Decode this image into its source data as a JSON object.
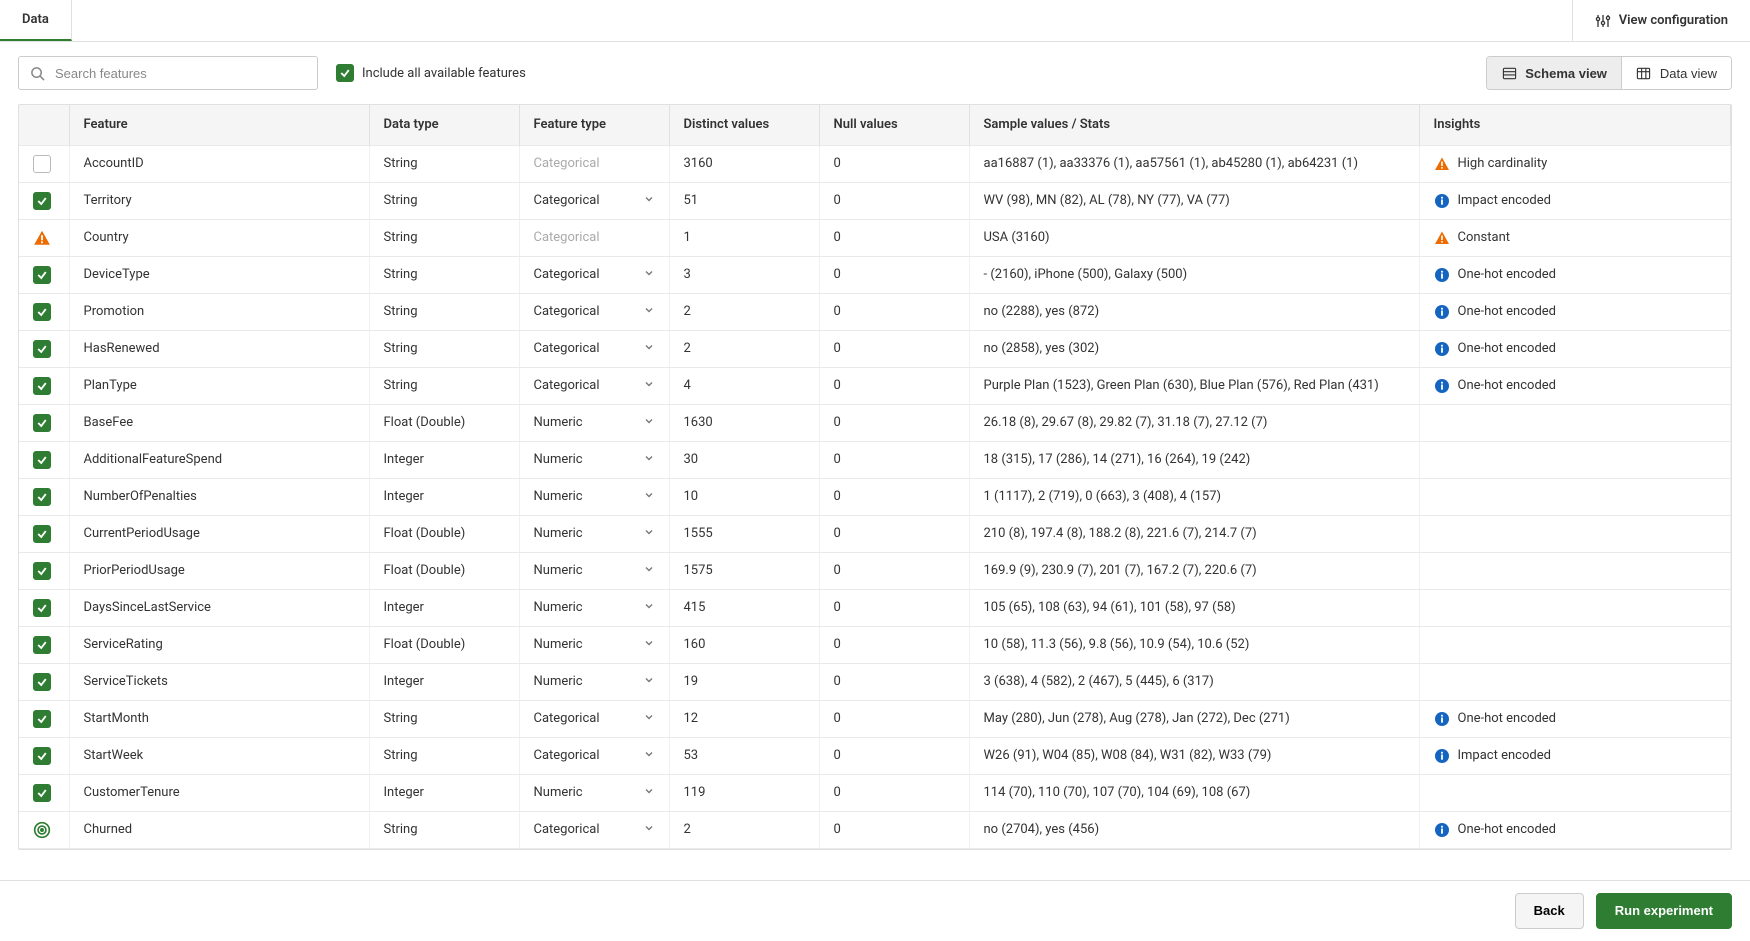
{
  "tabs": {
    "data": "Data"
  },
  "topbar": {
    "view_configuration": "View configuration"
  },
  "toolbar": {
    "search_placeholder": "Search features",
    "include_all": "Include all available features",
    "schema_view": "Schema view",
    "data_view": "Data view"
  },
  "columns": {
    "feature": "Feature",
    "data_type": "Data type",
    "feature_type": "Feature type",
    "distinct": "Distinct values",
    "nulls": "Null values",
    "samples": "Sample values / Stats",
    "insights": "Insights"
  },
  "insight_labels": {
    "high_cardinality": "High cardinality",
    "impact_encoded": "Impact encoded",
    "constant": "Constant",
    "one_hot": "One-hot encoded"
  },
  "footer": {
    "back": "Back",
    "run": "Run experiment"
  },
  "rows": [
    {
      "sel": "unchecked",
      "feature": "AccountID",
      "data_type": "String",
      "feature_type": "Categorical",
      "ft_muted": true,
      "ft_chevron": false,
      "distinct": "3160",
      "nulls": "0",
      "samples": "aa16887 (1), aa33376 (1), aa57561 (1), ab45280 (1), ab64231 (1)",
      "insight_icon": "warn",
      "insight_key": "high_cardinality"
    },
    {
      "sel": "checked",
      "feature": "Territory",
      "data_type": "String",
      "feature_type": "Categorical",
      "ft_muted": false,
      "ft_chevron": true,
      "distinct": "51",
      "nulls": "0",
      "samples": "WV (98), MN (82), AL (78), NY (77), VA (77)",
      "insight_icon": "info",
      "insight_key": "impact_encoded"
    },
    {
      "sel": "warn",
      "feature": "Country",
      "data_type": "String",
      "feature_type": "Categorical",
      "ft_muted": true,
      "ft_chevron": false,
      "distinct": "1",
      "nulls": "0",
      "samples": "USA (3160)",
      "insight_icon": "warn",
      "insight_key": "constant"
    },
    {
      "sel": "checked",
      "feature": "DeviceType",
      "data_type": "String",
      "feature_type": "Categorical",
      "ft_muted": false,
      "ft_chevron": true,
      "distinct": "3",
      "nulls": "0",
      "samples": "- (2160), iPhone (500), Galaxy (500)",
      "insight_icon": "info",
      "insight_key": "one_hot"
    },
    {
      "sel": "checked",
      "feature": "Promotion",
      "data_type": "String",
      "feature_type": "Categorical",
      "ft_muted": false,
      "ft_chevron": true,
      "distinct": "2",
      "nulls": "0",
      "samples": "no (2288), yes (872)",
      "insight_icon": "info",
      "insight_key": "one_hot"
    },
    {
      "sel": "checked",
      "feature": "HasRenewed",
      "data_type": "String",
      "feature_type": "Categorical",
      "ft_muted": false,
      "ft_chevron": true,
      "distinct": "2",
      "nulls": "0",
      "samples": "no (2858), yes (302)",
      "insight_icon": "info",
      "insight_key": "one_hot"
    },
    {
      "sel": "checked",
      "feature": "PlanType",
      "data_type": "String",
      "feature_type": "Categorical",
      "ft_muted": false,
      "ft_chevron": true,
      "distinct": "4",
      "nulls": "0",
      "samples": "Purple Plan (1523), Green Plan (630), Blue Plan (576), Red Plan (431)",
      "insight_icon": "info",
      "insight_key": "one_hot"
    },
    {
      "sel": "checked",
      "feature": "BaseFee",
      "data_type": "Float (Double)",
      "feature_type": "Numeric",
      "ft_muted": false,
      "ft_chevron": true,
      "distinct": "1630",
      "nulls": "0",
      "samples": "26.18 (8), 29.67 (8), 29.82 (7), 31.18 (7), 27.12 (7)",
      "insight_icon": "",
      "insight_key": ""
    },
    {
      "sel": "checked",
      "feature": "AdditionalFeatureSpend",
      "data_type": "Integer",
      "feature_type": "Numeric",
      "ft_muted": false,
      "ft_chevron": true,
      "distinct": "30",
      "nulls": "0",
      "samples": "18 (315), 17 (286), 14 (271), 16 (264), 19 (242)",
      "insight_icon": "",
      "insight_key": ""
    },
    {
      "sel": "checked",
      "feature": "NumberOfPenalties",
      "data_type": "Integer",
      "feature_type": "Numeric",
      "ft_muted": false,
      "ft_chevron": true,
      "distinct": "10",
      "nulls": "0",
      "samples": "1 (1117), 2 (719), 0 (663), 3 (408), 4 (157)",
      "insight_icon": "",
      "insight_key": ""
    },
    {
      "sel": "checked",
      "feature": "CurrentPeriodUsage",
      "data_type": "Float (Double)",
      "feature_type": "Numeric",
      "ft_muted": false,
      "ft_chevron": true,
      "distinct": "1555",
      "nulls": "0",
      "samples": "210 (8), 197.4 (8), 188.2 (8), 221.6 (7), 214.7 (7)",
      "insight_icon": "",
      "insight_key": ""
    },
    {
      "sel": "checked",
      "feature": "PriorPeriodUsage",
      "data_type": "Float (Double)",
      "feature_type": "Numeric",
      "ft_muted": false,
      "ft_chevron": true,
      "distinct": "1575",
      "nulls": "0",
      "samples": "169.9 (9), 230.9 (7), 201 (7), 167.2 (7), 220.6 (7)",
      "insight_icon": "",
      "insight_key": ""
    },
    {
      "sel": "checked",
      "feature": "DaysSinceLastService",
      "data_type": "Integer",
      "feature_type": "Numeric",
      "ft_muted": false,
      "ft_chevron": true,
      "distinct": "415",
      "nulls": "0",
      "samples": "105 (65), 108 (63), 94 (61), 101 (58), 97 (58)",
      "insight_icon": "",
      "insight_key": ""
    },
    {
      "sel": "checked",
      "feature": "ServiceRating",
      "data_type": "Float (Double)",
      "feature_type": "Numeric",
      "ft_muted": false,
      "ft_chevron": true,
      "distinct": "160",
      "nulls": "0",
      "samples": "10 (58), 11.3 (56), 9.8 (56), 10.9 (54), 10.6 (52)",
      "insight_icon": "",
      "insight_key": ""
    },
    {
      "sel": "checked",
      "feature": "ServiceTickets",
      "data_type": "Integer",
      "feature_type": "Numeric",
      "ft_muted": false,
      "ft_chevron": true,
      "distinct": "19",
      "nulls": "0",
      "samples": "3 (638), 4 (582), 2 (467), 5 (445), 6 (317)",
      "insight_icon": "",
      "insight_key": ""
    },
    {
      "sel": "checked",
      "feature": "StartMonth",
      "data_type": "String",
      "feature_type": "Categorical",
      "ft_muted": false,
      "ft_chevron": true,
      "distinct": "12",
      "nulls": "0",
      "samples": "May (280), Jun (278), Aug (278), Jan (272), Dec (271)",
      "insight_icon": "info",
      "insight_key": "one_hot"
    },
    {
      "sel": "checked",
      "feature": "StartWeek",
      "data_type": "String",
      "feature_type": "Categorical",
      "ft_muted": false,
      "ft_chevron": true,
      "distinct": "53",
      "nulls": "0",
      "samples": "W26 (91), W04 (85), W08 (84), W31 (82), W33 (79)",
      "insight_icon": "info",
      "insight_key": "impact_encoded"
    },
    {
      "sel": "checked",
      "feature": "CustomerTenure",
      "data_type": "Integer",
      "feature_type": "Numeric",
      "ft_muted": false,
      "ft_chevron": true,
      "distinct": "119",
      "nulls": "0",
      "samples": "114 (70), 110 (70), 107 (70), 104 (69), 108 (67)",
      "insight_icon": "",
      "insight_key": ""
    },
    {
      "sel": "target",
      "feature": "Churned",
      "data_type": "String",
      "feature_type": "Categorical",
      "ft_muted": false,
      "ft_chevron": true,
      "distinct": "2",
      "nulls": "0",
      "samples": "no (2704), yes (456)",
      "insight_icon": "info",
      "insight_key": "one_hot"
    }
  ]
}
